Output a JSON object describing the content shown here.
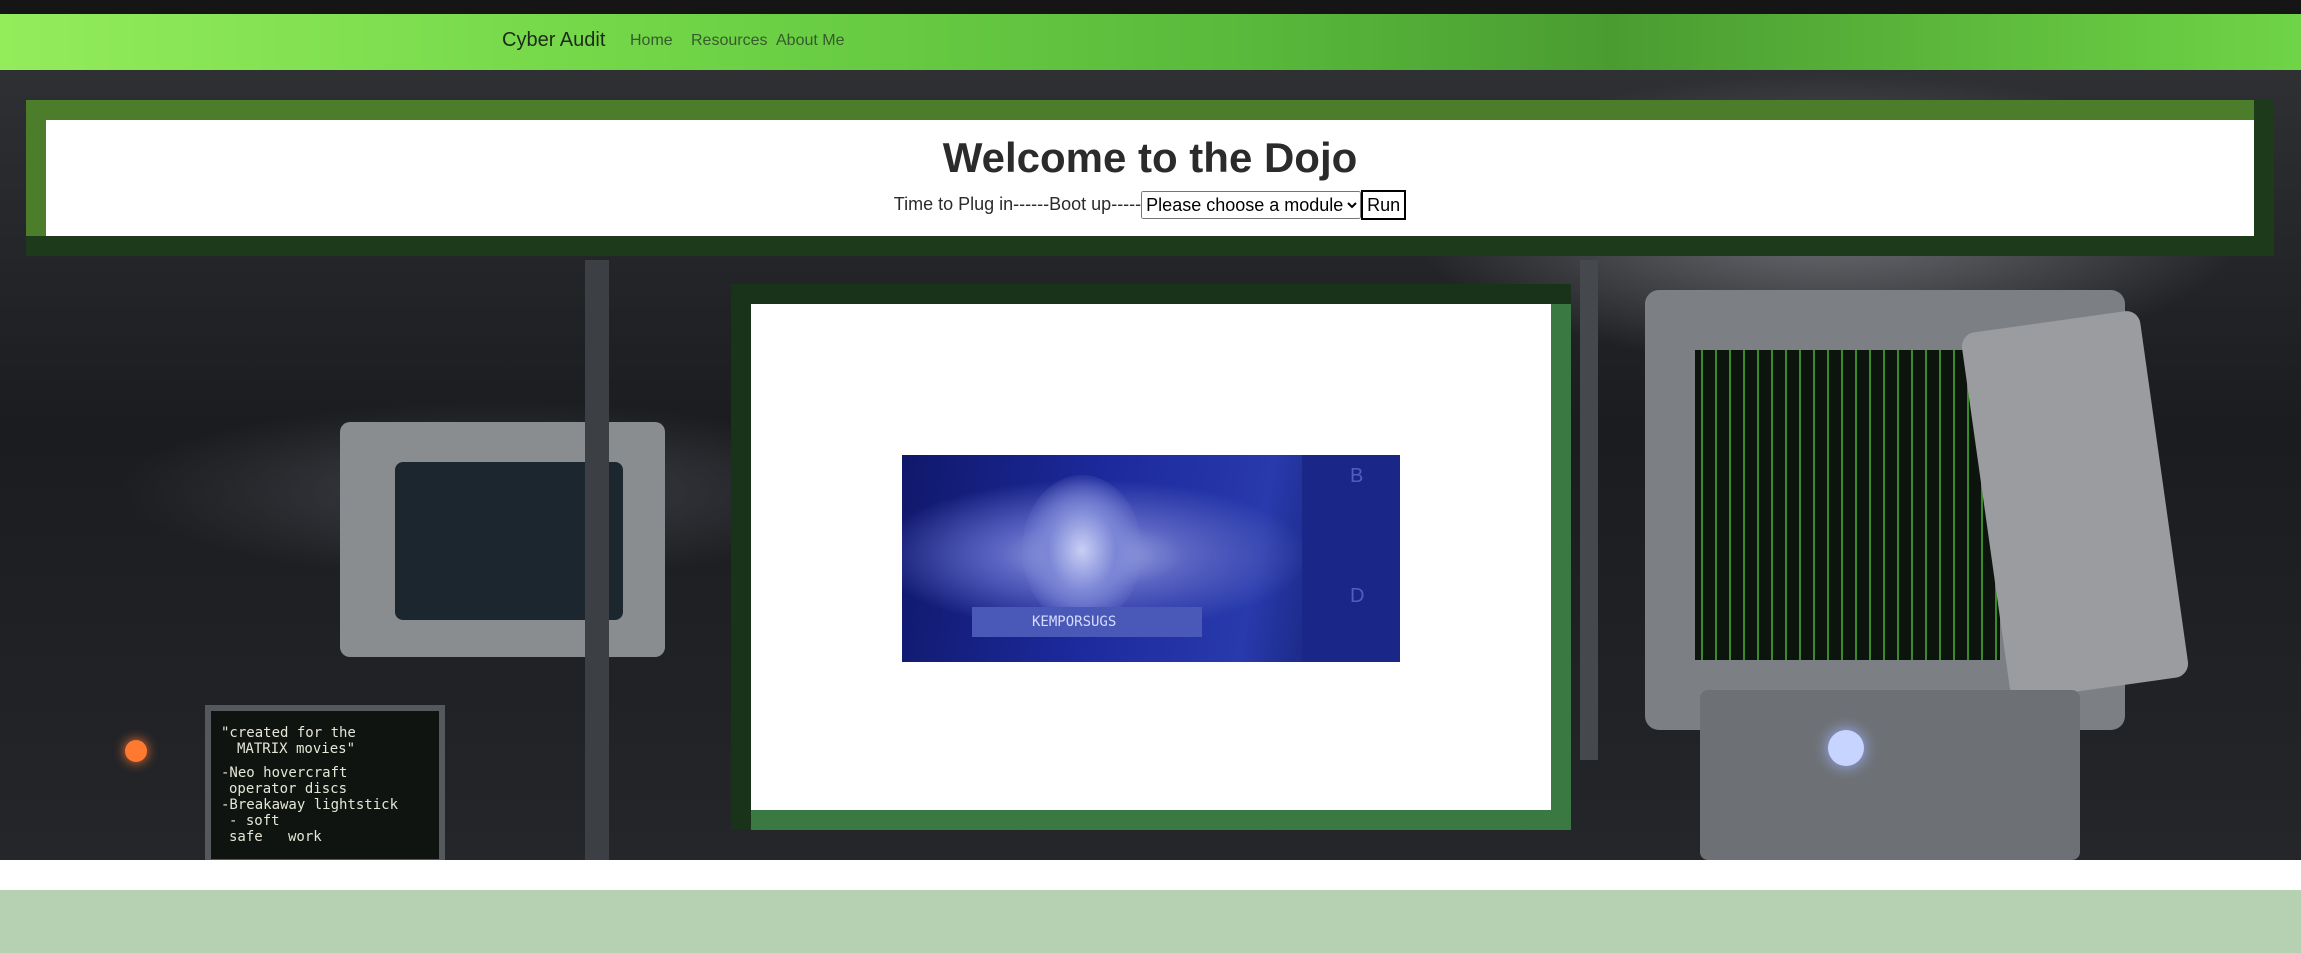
{
  "navbar": {
    "brand": "Cyber Audit",
    "links": [
      "Home",
      "Resources",
      "About Me"
    ]
  },
  "hero": {
    "title": "Welcome to the Dojo",
    "prompt_text": "Time to Plug in------Boot up-----",
    "module_select": {
      "selected": "Please choose a module",
      "options": [
        "Please choose a module"
      ]
    },
    "run_label": "Run"
  },
  "image": {
    "caption_text": "KEMPORSUGS",
    "side_letters": [
      "B",
      "D"
    ]
  },
  "background": {
    "sign_lines": [
      "\"created for the",
      "MATRIX movies\"",
      "-Neo hovercraft",
      "operator discs",
      "-Breakaway lightstick",
      "- soft",
      "safe   work"
    ]
  },
  "colors": {
    "nav_green": "#6fd446",
    "frame_green": "#4b7d2a",
    "frame_shadow": "#1d3a1a",
    "footer_green": "#b6d1b2"
  }
}
